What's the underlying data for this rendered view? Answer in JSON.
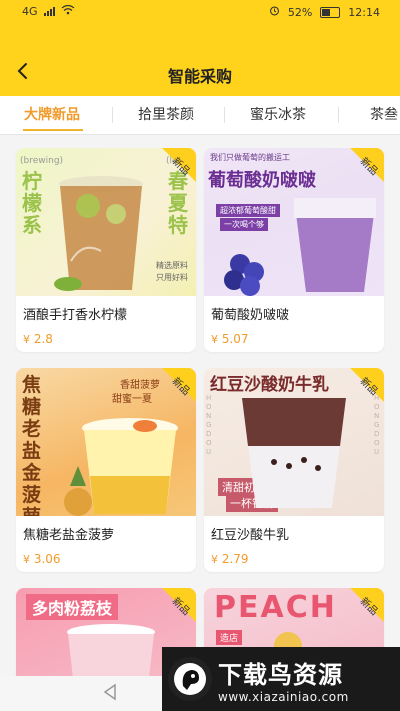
{
  "status": {
    "left_indicators": "4G",
    "battery": "52%",
    "time": "12:14"
  },
  "header": {
    "title": "智能采购"
  },
  "tabs": [
    {
      "label": "大牌新品",
      "active": true
    },
    {
      "label": "拾里茶颜",
      "active": false
    },
    {
      "label": "蜜乐冰茶",
      "active": false
    },
    {
      "label": "茶叁",
      "active": false
    }
  ],
  "products": [
    {
      "name": "酒酿手打香水柠檬",
      "price": "2.8",
      "badge": "新品",
      "image_text": {
        "left": "柠檬系",
        "right": "春夏特",
        "tl": "(brewing)",
        "tr": "(le",
        "small1": "精选原料",
        "small2": "只用好料"
      }
    },
    {
      "name": "葡萄酸奶啵啵",
      "price": "5.07",
      "badge": "新品",
      "image_text": {
        "top": "我们只做葡萄的搬运工",
        "main": "葡萄酸奶啵啵",
        "sub1": "超浓郁葡萄酸甜",
        "sub2": "一次喝个够"
      }
    },
    {
      "name": "焦糖老盐金菠萝",
      "price": "3.06",
      "badge": "新品",
      "image_text": {
        "left": "焦糖老盐金菠萝",
        "r1": "香甜菠萝",
        "r2": "甜蜜一夏"
      }
    },
    {
      "name": "红豆沙酸牛乳",
      "price": "2.79",
      "badge": "新品",
      "image_text": {
        "main": "红豆沙酸奶牛乳",
        "sub1": "清甜初开",
        "sub2": "一杯钟情",
        "side1": "HONGDOU",
        "side2": "HONGDOU"
      }
    },
    {
      "name": "",
      "price": "",
      "badge": "新品",
      "image_text": {
        "main": "多肉粉荔枝"
      }
    },
    {
      "name": "",
      "price": "",
      "badge": "新品",
      "image_text": {
        "main": "PEACH",
        "small": "造店"
      }
    }
  ],
  "currency": "¥",
  "watermark": {
    "main": "下载鸟资源",
    "sub": "www.xiazainiao.com"
  }
}
